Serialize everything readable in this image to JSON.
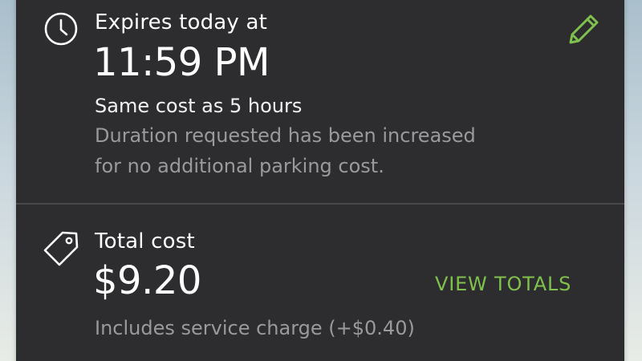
{
  "expiry": {
    "label": "Expires today at",
    "time": "11:59 PM",
    "cost_note": "Same cost as 5 hours",
    "detail_line1": "Duration requested has been increased",
    "detail_line2": "for no additional parking cost.",
    "clock_icon": "clock-icon",
    "edit_icon": "pencil-icon"
  },
  "total": {
    "label": "Total cost",
    "amount": "$9.20",
    "view_totals_label": "VIEW TOTALS",
    "service_note": "Includes service charge (+$0.40)",
    "tag_icon": "price-tag-icon"
  },
  "colors": {
    "card_bg": "#2d2d2f",
    "accent_green": "#7fc14c",
    "muted_text": "#9a9a9c"
  }
}
